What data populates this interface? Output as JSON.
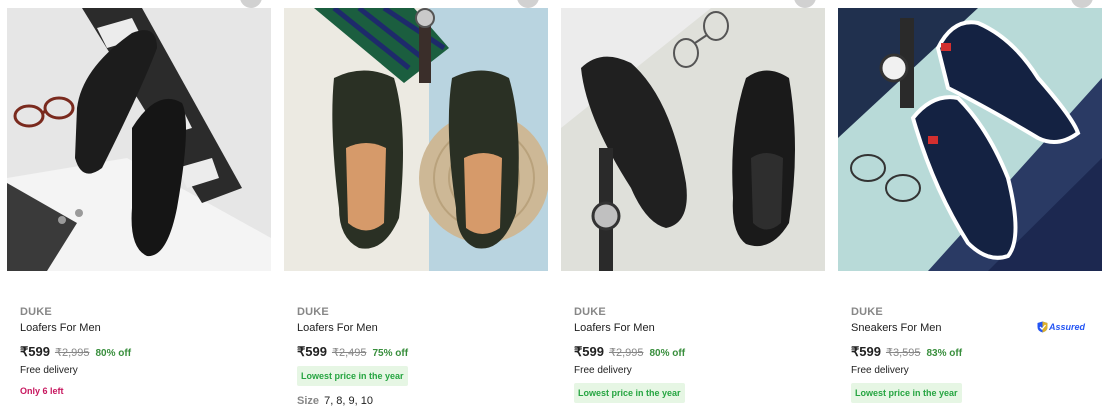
{
  "products": [
    {
      "brand": "DUKE",
      "title": "Loafers For Men",
      "price": "₹599",
      "mrp": "₹2,995",
      "discount": "80% off",
      "delivery": "Free delivery",
      "stock": "Only 6 left",
      "lowest": "",
      "sizes_label": "",
      "sizes": "",
      "assured": "",
      "image_icon": "loafers-photo-icon"
    },
    {
      "brand": "DUKE",
      "title": "Loafers For Men",
      "price": "₹599",
      "mrp": "₹2,495",
      "discount": "75% off",
      "delivery": "",
      "stock": "",
      "lowest": "Lowest price in the year",
      "sizes_label": "Size",
      "sizes": "7, 8, 9, 10",
      "assured": "",
      "image_icon": "loafers-photo-icon"
    },
    {
      "brand": "DUKE",
      "title": "Loafers For Men",
      "price": "₹599",
      "mrp": "₹2,995",
      "discount": "80% off",
      "delivery": "Free delivery",
      "stock": "",
      "lowest": "Lowest price in the year",
      "sizes_label": "",
      "sizes": "",
      "assured": "",
      "image_icon": "loafers-photo-icon"
    },
    {
      "brand": "DUKE",
      "title": "Sneakers For Men",
      "price": "₹599",
      "mrp": "₹3,595",
      "discount": "83% off",
      "delivery": "Free delivery",
      "stock": "",
      "lowest": "Lowest price in the year",
      "sizes_label": "",
      "sizes": "",
      "assured": "Assured",
      "image_icon": "sneakers-photo-icon"
    }
  ],
  "colors": {
    "discount_green": "#388e3c",
    "lowest_price_bg": "#e6f6e4",
    "stock_pink": "#c7165e",
    "assured_blue": "#2455f4"
  }
}
